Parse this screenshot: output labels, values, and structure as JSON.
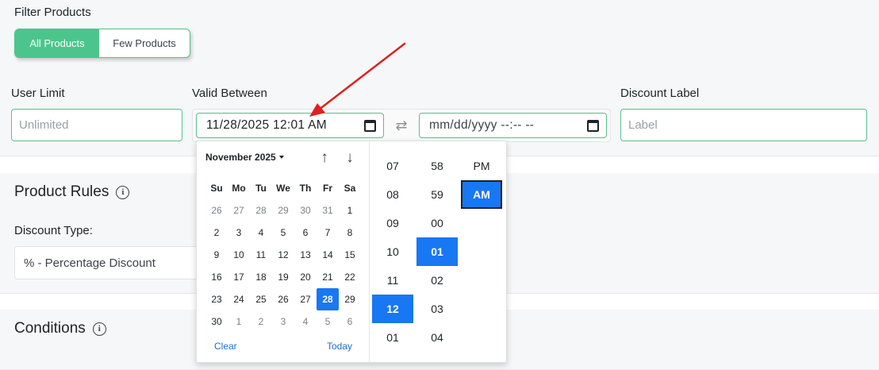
{
  "filter": {
    "label": "Filter Products",
    "options": [
      "All Products",
      "Few Products"
    ],
    "selected": "All Products"
  },
  "user_limit": {
    "label": "User Limit",
    "placeholder": "Unlimited"
  },
  "valid_between": {
    "label": "Valid Between",
    "start_value": "11/28/2025 12:01 AM",
    "end_value": "mm/dd/yyyy --:-- --"
  },
  "discount_label": {
    "label": "Discount Label",
    "placeholder": "Label"
  },
  "product_rules": {
    "title": "Product Rules",
    "discount_type_label": "Discount Type:",
    "discount_type_value": "% - Percentage Discount"
  },
  "conditions": {
    "title": "Conditions"
  },
  "datepicker": {
    "month_label": "November 2025",
    "weekdays": [
      "Su",
      "Mo",
      "Tu",
      "We",
      "Th",
      "Fr",
      "Sa"
    ],
    "weeks": [
      [
        [
          "26",
          1
        ],
        [
          "27",
          1
        ],
        [
          "28",
          1
        ],
        [
          "29",
          1
        ],
        [
          "30",
          1
        ],
        [
          "31",
          1
        ],
        [
          "1",
          0
        ]
      ],
      [
        [
          "2",
          0
        ],
        [
          "3",
          0
        ],
        [
          "4",
          0
        ],
        [
          "5",
          0
        ],
        [
          "6",
          0
        ],
        [
          "7",
          0
        ],
        [
          "8",
          0
        ]
      ],
      [
        [
          "9",
          0
        ],
        [
          "10",
          0
        ],
        [
          "11",
          0
        ],
        [
          "12",
          0
        ],
        [
          "13",
          0
        ],
        [
          "14",
          0
        ],
        [
          "15",
          0
        ]
      ],
      [
        [
          "16",
          0
        ],
        [
          "17",
          0
        ],
        [
          "18",
          0
        ],
        [
          "19",
          0
        ],
        [
          "20",
          0
        ],
        [
          "21",
          0
        ],
        [
          "22",
          0
        ]
      ],
      [
        [
          "23",
          0
        ],
        [
          "24",
          0
        ],
        [
          "25",
          0
        ],
        [
          "26",
          0
        ],
        [
          "27",
          0
        ],
        [
          "28",
          0
        ],
        [
          "29",
          0
        ]
      ],
      [
        [
          "30",
          0
        ],
        [
          "1",
          1
        ],
        [
          "2",
          1
        ],
        [
          "3",
          1
        ],
        [
          "4",
          1
        ],
        [
          "5",
          1
        ],
        [
          "6",
          1
        ]
      ]
    ],
    "selected_day": "28",
    "clear_label": "Clear",
    "today_label": "Today",
    "hours": [
      "07",
      "08",
      "09",
      "10",
      "11",
      "12",
      "01"
    ],
    "selected_hour": "12",
    "minutes": [
      "58",
      "59",
      "00",
      "01",
      "02",
      "03",
      "04"
    ],
    "selected_minute": "01",
    "periods": [
      "PM",
      "AM"
    ],
    "selected_period": "AM"
  },
  "colors": {
    "accent_green": "#4cc58c",
    "selection_blue": "#1877f2",
    "annotation_red": "#e02020"
  }
}
